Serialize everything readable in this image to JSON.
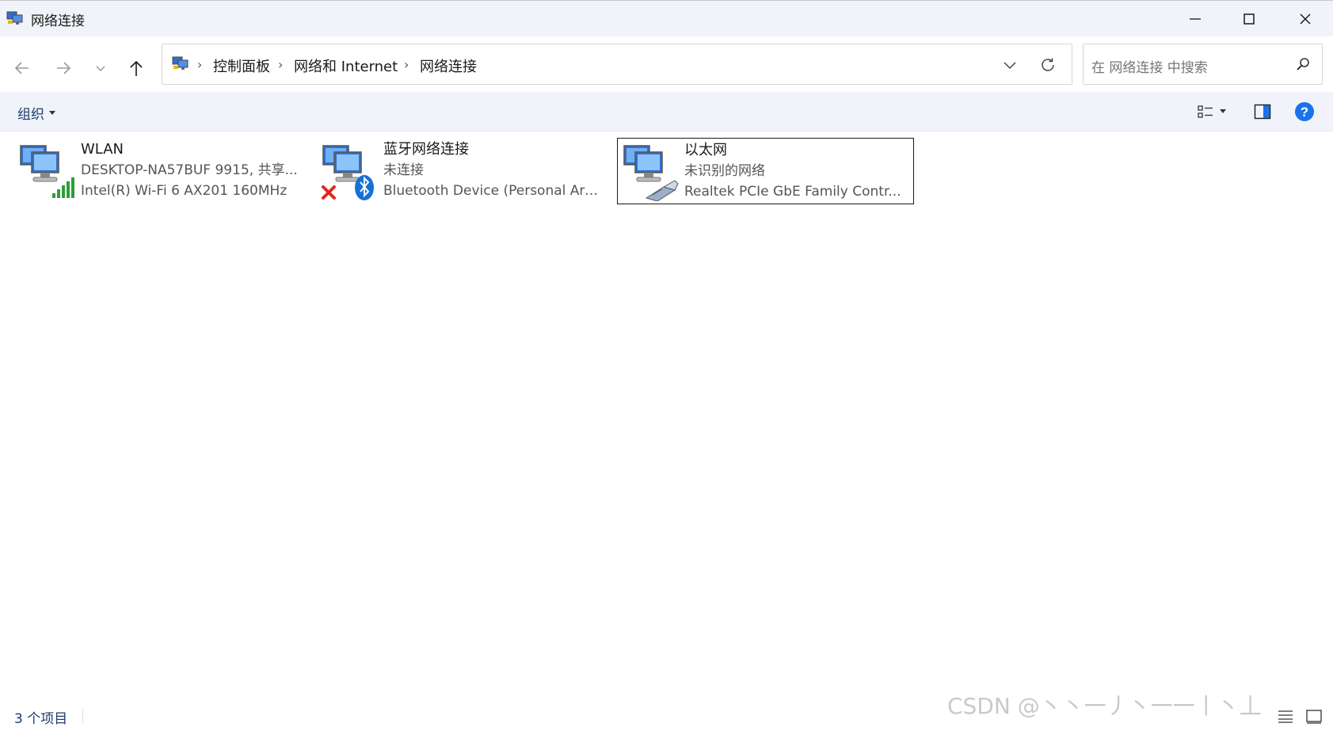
{
  "window": {
    "title": "网络连接",
    "icons": [
      "network-connections-icon",
      "minimize-icon",
      "maximize-icon",
      "close-icon"
    ]
  },
  "nav": {
    "breadcrumb": [
      "控制面板",
      "网络和 Internet",
      "网络连接"
    ],
    "search_placeholder": "在 网络连接 中搜索",
    "icons": [
      "back-arrow-icon",
      "forward-arrow-icon",
      "chevron-down-icon",
      "up-arrow-icon",
      "chevron-down-icon",
      "refresh-icon",
      "search-icon"
    ]
  },
  "toolbar": {
    "organize_label": "组织",
    "icons": [
      "view-options-icon",
      "preview-pane-icon",
      "help-icon"
    ]
  },
  "items": [
    {
      "name": "WLAN",
      "line1": "DESKTOP-NA57BUF 9915, 共享...",
      "line2": "Intel(R) Wi-Fi 6 AX201 160MHz",
      "icon": "wifi-adapter-icon",
      "selected": false
    },
    {
      "name": "蓝牙网络连接",
      "line1": "未连接",
      "line2": "Bluetooth Device (Personal Are...",
      "icon": "bluetooth-adapter-disconnected-icon",
      "selected": false
    },
    {
      "name": "以太网",
      "line1": "未识别的网络",
      "line2": "Realtek PCIe GbE Family Contr...",
      "icon": "ethernet-adapter-icon",
      "selected": true
    }
  ],
  "status": {
    "item_count": "3 个项目",
    "watermark": "CSDN @丶丶一丿丶一一丨丶丄"
  },
  "colors": {
    "titlebar_bg": "#f0f3f9",
    "link_blue": "#1c3a6e",
    "help_blue": "#1a73e8",
    "bluetooth_blue": "#1670d8",
    "error_red": "#e0281e",
    "signal_green": "#2e9e3c"
  }
}
